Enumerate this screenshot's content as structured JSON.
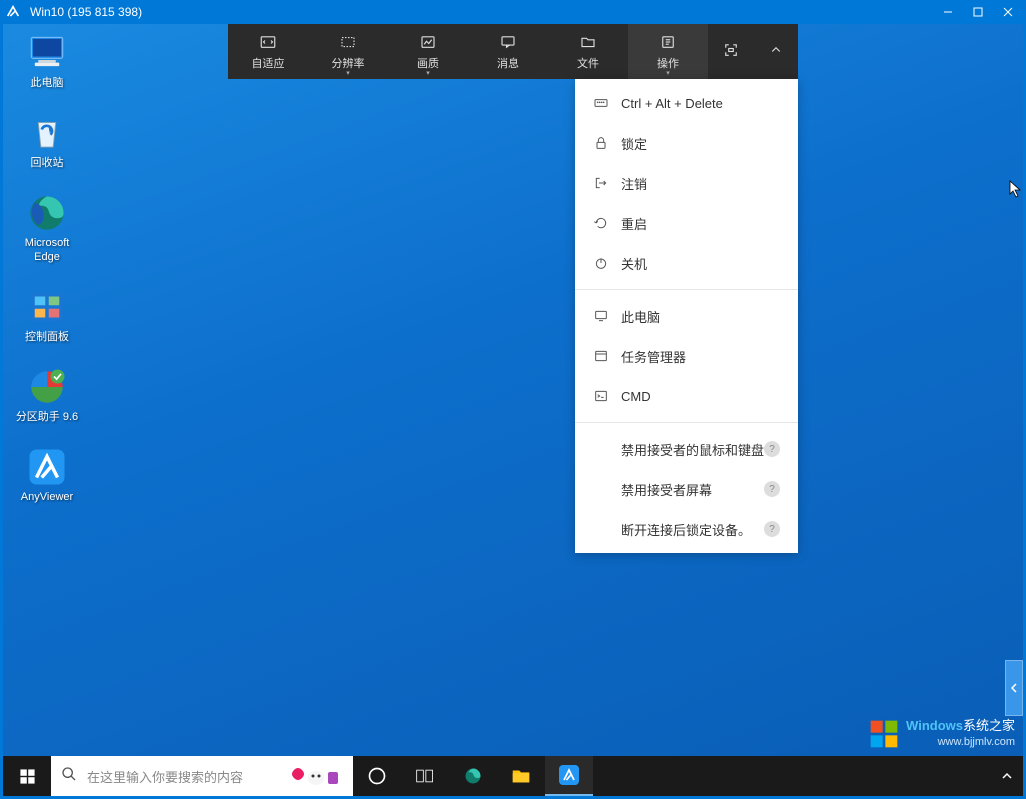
{
  "titlebar": {
    "title": "Win10 (195 815 398)"
  },
  "toolbar": {
    "items": [
      {
        "label": "自适应",
        "icon": "fit"
      },
      {
        "label": "分辨率",
        "icon": "resolution",
        "chevron": true
      },
      {
        "label": "画质",
        "icon": "quality",
        "chevron": true
      },
      {
        "label": "消息",
        "icon": "message"
      },
      {
        "label": "文件",
        "icon": "file"
      },
      {
        "label": "操作",
        "icon": "action",
        "chevron": true,
        "active": true
      }
    ]
  },
  "dropdown": {
    "items": [
      {
        "label": "Ctrl + Alt + Delete",
        "icon": "keyboard"
      },
      {
        "label": "锁定",
        "icon": "lock"
      },
      {
        "label": "注销",
        "icon": "logout"
      },
      {
        "label": "重启",
        "icon": "restart"
      },
      {
        "label": "关机",
        "icon": "power"
      },
      {
        "sep": true
      },
      {
        "label": "此电脑",
        "icon": "pc"
      },
      {
        "label": "任务管理器",
        "icon": "taskmgr"
      },
      {
        "label": "CMD",
        "icon": "cmd"
      },
      {
        "sep": true
      },
      {
        "label": "禁用接受者的鼠标和键盘",
        "help": true
      },
      {
        "label": "禁用接受者屏幕",
        "help": true
      },
      {
        "label": "断开连接后锁定设备。",
        "help": true
      }
    ]
  },
  "desktop": {
    "icons": [
      {
        "label": "此电脑",
        "type": "pc"
      },
      {
        "label": "回收站",
        "type": "recycle"
      },
      {
        "label": "Microsoft\nEdge",
        "type": "edge"
      },
      {
        "label": "控制面板",
        "type": "control"
      },
      {
        "label": "分区助手 9.6",
        "type": "partition"
      },
      {
        "label": "AnyViewer",
        "type": "anyviewer"
      }
    ]
  },
  "taskbar": {
    "search_placeholder": "在这里输入你要搜索的内容"
  },
  "watermark": {
    "brand": "Windows",
    "suffix": "系统之家",
    "url": "www.bjjmlv.com"
  }
}
